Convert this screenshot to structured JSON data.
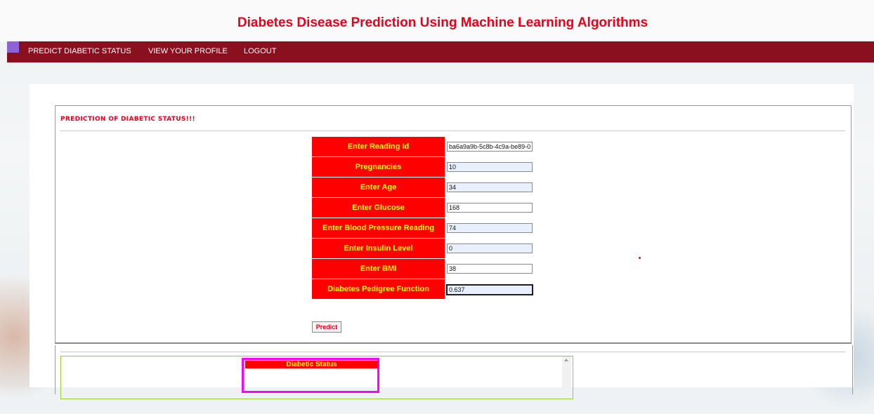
{
  "app": {
    "title": "Diabetes Disease Prediction Using Machine Learning Algorithms"
  },
  "nav": {
    "items": [
      "PREDICT DIABETIC STATUS",
      "VIEW YOUR PROFILE",
      "LOGOUT"
    ]
  },
  "form": {
    "section_title": "PREDICTION OF DIABETIC STATUS!!!",
    "fields": [
      {
        "label": "Enter Reading Id",
        "value": "ba6a9a9b-5c8b-4c9a-be89-0"
      },
      {
        "label": "Pregnancies",
        "value": "10"
      },
      {
        "label": "Enter Age",
        "value": "34"
      },
      {
        "label": "Enter Glucose",
        "value": "168"
      },
      {
        "label": "Enter Blood Pressure Reading",
        "value": "74"
      },
      {
        "label": "Enter Insulin Level",
        "value": "0"
      },
      {
        "label": "Enter BMI",
        "value": "38"
      },
      {
        "label": "Diabetes Pedigree Function",
        "value": "0.637"
      }
    ],
    "predict_label": "Predict"
  },
  "result": {
    "header": "Diabetic Status"
  },
  "colors": {
    "accent": "#e8001c",
    "navbar": "#8a1020",
    "label_bg": "#ff0000",
    "label_text": "#ffff00",
    "result_border": "#ff00ff"
  }
}
